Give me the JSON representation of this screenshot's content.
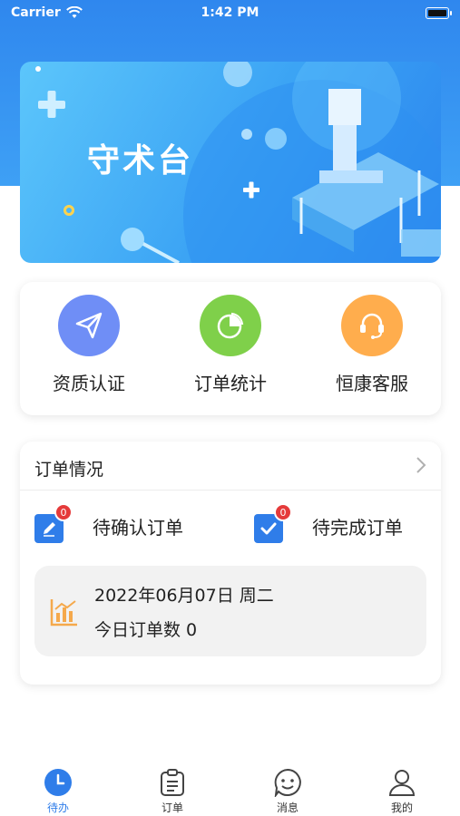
{
  "status_bar": {
    "carrier": "Carrier",
    "time": "1:42 PM"
  },
  "banner": {
    "title": "守术台"
  },
  "quick_actions": [
    {
      "label": "资质认证",
      "icon": "paper-plane-icon",
      "color": "#6f8ef6"
    },
    {
      "label": "订单统计",
      "icon": "pie-chart-icon",
      "color": "#7fd04a"
    },
    {
      "label": "恒康客服",
      "icon": "headset-icon",
      "color": "#ffad4d"
    }
  ],
  "orders": {
    "title": "订单情况",
    "pending_confirm": {
      "label": "待确认订单",
      "count": "0"
    },
    "pending_complete": {
      "label": "待完成订单",
      "count": "0"
    },
    "date": "2022年06月07日 周二",
    "today_count": "今日订单数 0"
  },
  "tabs": [
    {
      "label": "待办",
      "icon": "clock-icon",
      "active": true
    },
    {
      "label": "订单",
      "icon": "clipboard-icon",
      "active": false
    },
    {
      "label": "消息",
      "icon": "chat-face-icon",
      "active": false
    },
    {
      "label": "我的",
      "icon": "person-icon",
      "active": false
    }
  ],
  "colors": {
    "primary": "#2f7de9",
    "badge": "#e53a3a",
    "header": "#3a95f2"
  }
}
